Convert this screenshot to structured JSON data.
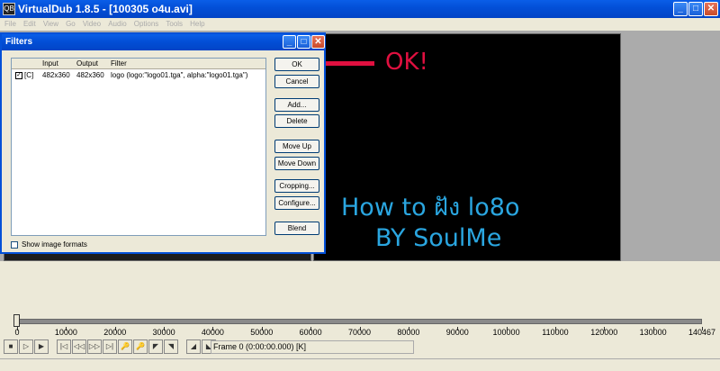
{
  "window": {
    "title": "VirtualDub 1.8.5 - [100305 o4u.avi]",
    "icon_text": "QB"
  },
  "menu": [
    "File",
    "Edit",
    "View",
    "Go",
    "Video",
    "Audio",
    "Options",
    "Tools",
    "Help"
  ],
  "filters_dialog": {
    "title": "Filters",
    "columns": [
      "Input",
      "Output",
      "Filter"
    ],
    "rows": [
      {
        "checked": true,
        "flag": "[C]",
        "input": "482x360",
        "output": "482x360",
        "filter": "logo (logo:\"logo01.tga\", alpha:\"logo01.tga\")"
      }
    ],
    "buttons": {
      "ok": "OK",
      "cancel": "Cancel",
      "add": "Add...",
      "delete": "Delete",
      "move_up": "Move Up",
      "move_down": "Move Down",
      "cropping": "Cropping...",
      "configure": "Configure...",
      "blend": "Blend"
    },
    "show_image_formats": "Show image formats"
  },
  "annotation": {
    "ok_text": "OK!",
    "color": "#e01040"
  },
  "video_overlay": {
    "line1": "How to ฝัง lo8o",
    "line2": "BY SoulMe",
    "color": "#2aa6e0"
  },
  "timeline": {
    "ticks": [
      "0",
      "10000",
      "20000",
      "30000",
      "40000",
      "50000",
      "60000",
      "70000",
      "80000",
      "90000",
      "100000",
      "110000",
      "120000",
      "130000",
      "140467"
    ],
    "frame_status": "Frame 0 (0:00:00.000) [K]"
  }
}
